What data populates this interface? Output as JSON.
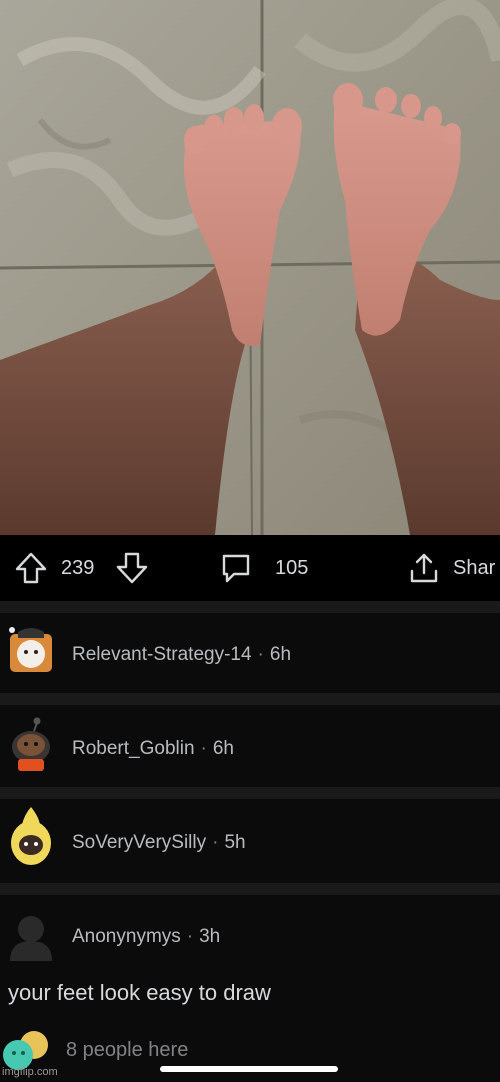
{
  "post": {
    "image_subject": "feet-photo",
    "upvotes": "239",
    "comments": "105",
    "share_label": "Shar"
  },
  "comments": [
    {
      "username": "Relevant-Strategy-14",
      "age": "6h",
      "body": ""
    },
    {
      "username": "Robert_Goblin",
      "age": "6h",
      "body": ""
    },
    {
      "username": "SoVeryVerySilly",
      "age": "5h",
      "body": ""
    },
    {
      "username": "Anonynymys",
      "age": "3h",
      "body": "your feet look easy to draw"
    }
  ],
  "presence": {
    "text": "8 people here"
  },
  "watermark": "imgflip.com",
  "colors": {
    "background": "#000000",
    "text": "#d7dadc",
    "muted": "#818384"
  }
}
